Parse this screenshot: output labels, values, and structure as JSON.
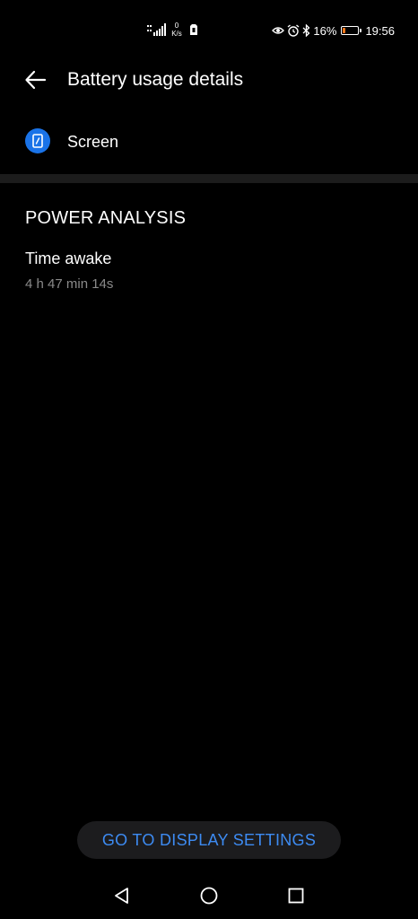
{
  "status_bar": {
    "network_speed_value": "0",
    "network_speed_unit": "K/s",
    "battery_percent": "16%",
    "battery_level": 0.16,
    "time": "19:56",
    "icons": [
      "signal-icon",
      "sim-icon",
      "eye-icon",
      "alarm-icon",
      "bluetooth-icon",
      "battery-icon"
    ]
  },
  "header": {
    "title": "Battery usage details",
    "back_icon": "arrow-left-icon"
  },
  "app": {
    "name": "Screen",
    "icon": "phone-screen-icon",
    "icon_color": "#1a73e8"
  },
  "section": {
    "title": "POWER ANALYSIS",
    "stats": [
      {
        "label": "Time awake",
        "value": "4 h 47 min 14s"
      }
    ]
  },
  "action": {
    "label": "GO TO DISPLAY SETTINGS",
    "color": "#3d8bf2"
  },
  "nav_bar": {
    "icons": [
      "nav-back-icon",
      "nav-home-icon",
      "nav-recents-icon"
    ]
  }
}
